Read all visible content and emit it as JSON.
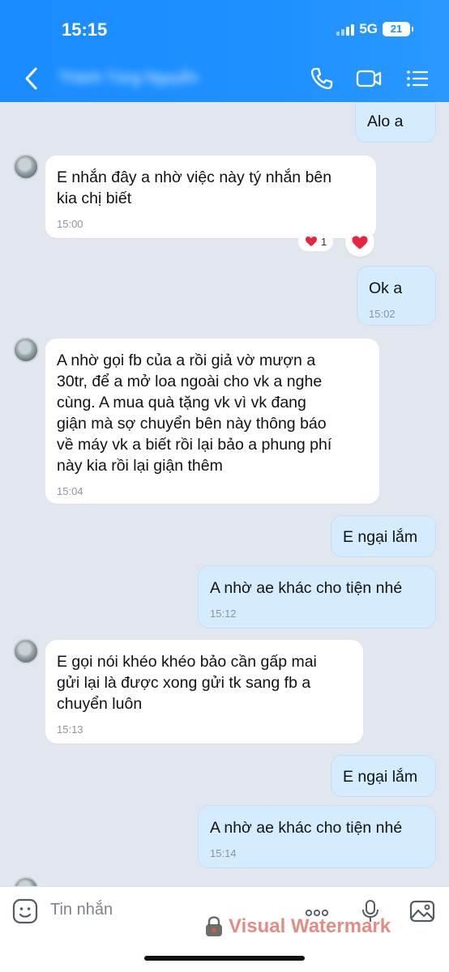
{
  "status": {
    "time": "15:15",
    "network": "5G",
    "battery": "21"
  },
  "header": {
    "contact_name": "Thành Tùng Nguyễn"
  },
  "messages": [
    {
      "text": "Alo a"
    },
    {
      "text": "E nhắn đây a nhờ việc này tý nhắn bên\nkia chị biết",
      "time": "15:00",
      "reaction_count": "1"
    },
    {
      "text": "Ok a",
      "time": "15:02"
    },
    {
      "text": "A nhờ gọi fb của a rồi giả vờ mượn a\n30tr, để a mở loa ngoài cho vk a nghe\ncùng. A mua quà tặng vk vì vk đang\ngiận mà sợ chuyển bên này thông  báo\nvề máy vk a biết rồi lại bảo a phung phí\nnày kia rồi lại giận thêm",
      "time": "15:04"
    },
    {
      "text": "E ngại lắm"
    },
    {
      "text": "A nhờ ae khác cho tiện nhé",
      "time": "15:12"
    },
    {
      "text": "E gọi nói khéo khéo bảo cần gấp mai\ngửi lại là được xong gửi tk sang fb a\nchuyển luôn",
      "time": "15:13"
    },
    {
      "text": "E ngại lắm"
    },
    {
      "text": "A nhờ ae khác cho tiện nhé",
      "time": "15:14"
    }
  ],
  "input": {
    "placeholder": "Tin nhắn"
  },
  "watermark": "Visual Watermark",
  "colors": {
    "header": "#1e90ff",
    "sent_bubble": "#d5ecfe",
    "received_bubble": "#ffffff",
    "background": "#e2e6ee"
  }
}
